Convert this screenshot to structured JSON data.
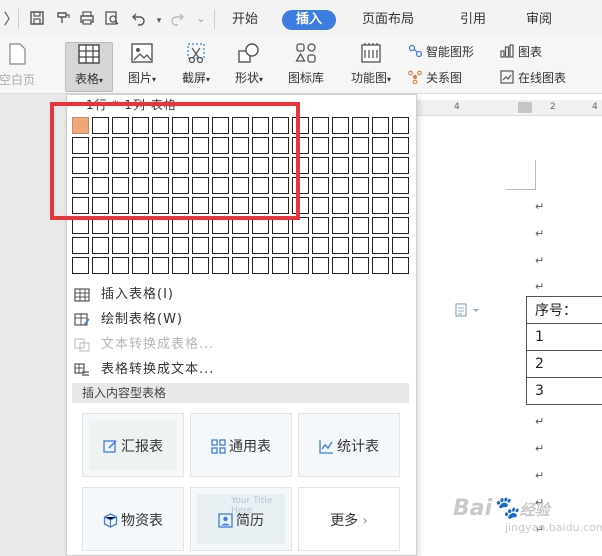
{
  "quick_access": {
    "menu_chevron": "〉"
  },
  "tabs": [
    {
      "label": "开始"
    },
    {
      "label": "插入"
    },
    {
      "label": "页面布局"
    },
    {
      "label": "引用"
    },
    {
      "label": "审阅"
    }
  ],
  "ribbon": {
    "blank_page": "空白页",
    "table": "表格",
    "picture": "图片",
    "screenshot": "截屏",
    "shapes": "形状",
    "icon_library": "图标库",
    "function_chart": "功能图",
    "smart_graphic": "智能图形",
    "chart": "图表",
    "relation_graph": "关系图",
    "online_chart": "在线图表"
  },
  "table_grid": {
    "label": "1行 * 1列 表格",
    "rows": 8,
    "cols": 17,
    "selected_rows": 1,
    "selected_cols": 1
  },
  "menu": {
    "insert_table": "插入表格(I)",
    "draw_table": "绘制表格(W)",
    "text_to_table": "文本转换成表格...",
    "table_to_text": "表格转换成文本..."
  },
  "section": {
    "title": "插入内容型表格"
  },
  "templates": [
    {
      "label": "汇报表",
      "icon": "edit-icon"
    },
    {
      "label": "通用表",
      "icon": "grid-icon"
    },
    {
      "label": "统计表",
      "icon": "line-chart-icon"
    },
    {
      "label": "物资表",
      "icon": "box-icon"
    },
    {
      "label": "简历",
      "icon": "person-icon"
    },
    {
      "label": "更多",
      "icon": "chevron-right-icon"
    }
  ],
  "template_preview": {
    "text": "Your Title Here"
  },
  "document": {
    "ruler_marks": [
      "4",
      "2",
      "4"
    ],
    "paragraph_mark": "↵",
    "table_rows": [
      {
        "value": "序号："
      },
      {
        "value": "1"
      },
      {
        "value": "2"
      },
      {
        "value": "3"
      }
    ]
  },
  "watermark": {
    "brand": "Bai",
    "suffix": "经验",
    "url": "jingyan.baidu.com"
  },
  "colors": {
    "accent": "#3d7ce0",
    "highlight_cell": "#f0a679",
    "annotation_red": "#e8343a"
  }
}
